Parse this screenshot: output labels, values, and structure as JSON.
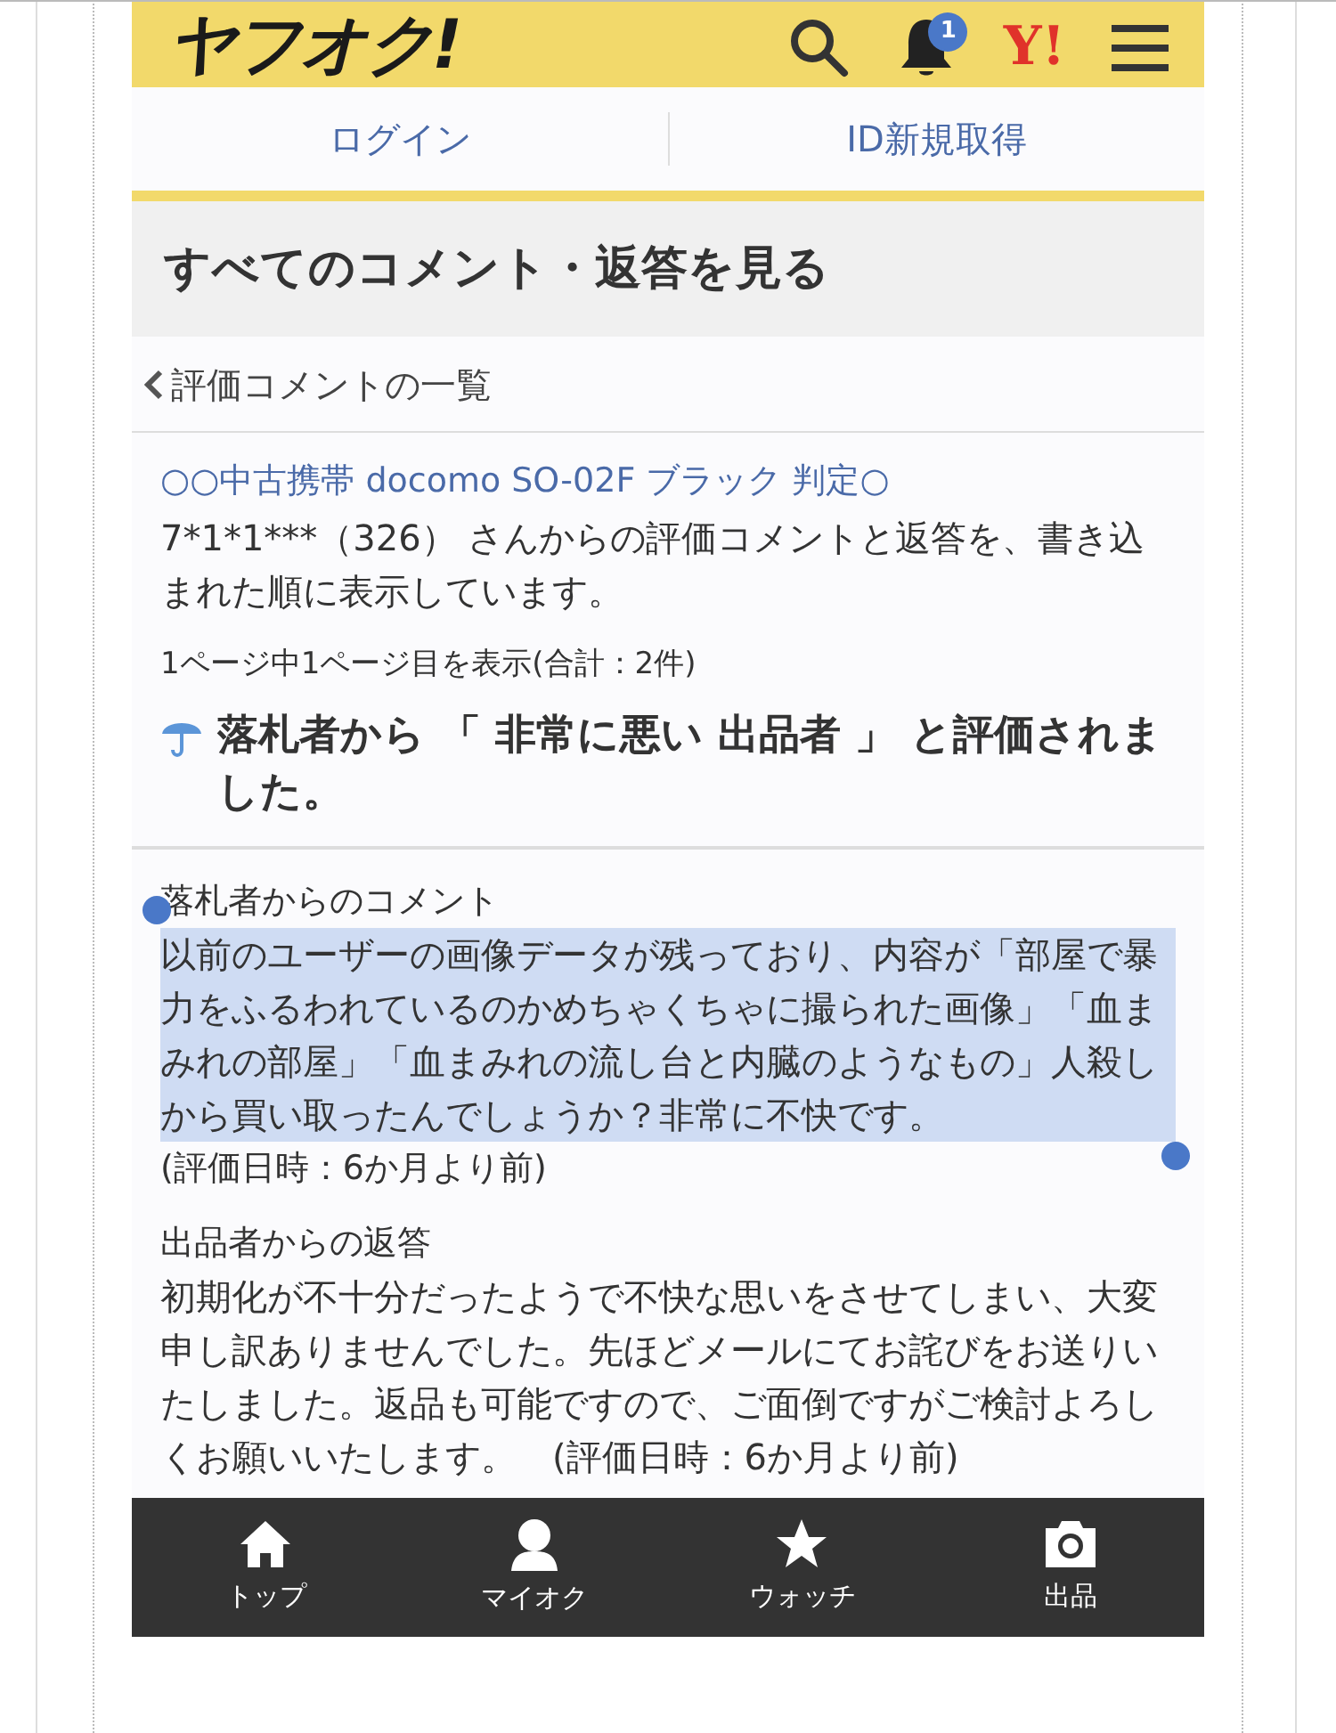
{
  "header": {
    "logo": "ヤフオク!",
    "notification_badge": "1",
    "yahoo_logo": "Y!"
  },
  "auth_links": [
    {
      "label": "ログイン"
    },
    {
      "label": "ID新規取得"
    }
  ],
  "page_title": "すべてのコメント・返答を見る",
  "back_link": "評価コメントの一覧",
  "item": {
    "title": "○○中古携帯 docomo SO-02F ブラック 判定○",
    "description": "7*1*1***（326） さんからの評価コメントと返答を、書き込まれた順に表示しています。",
    "page_info": "1ページ中1ページ目を表示(合計：2件)",
    "rating": "落札者から 「 非常に悪い 出品者 」 と評価されました。"
  },
  "comments": [
    {
      "heading": "落札者からのコメント",
      "body": "以前のユーザーの画像データが残っており、内容が「部屋で暴力をふるわれているのかめちゃくちゃに撮られた画像」「血まみれの部屋」「血まみれの流し台と内臓のようなもの」人殺しから買い取ったんでしょうか？非常に不快です。",
      "date": "(評価日時：6か月より前)",
      "highlighted": true
    },
    {
      "heading": "出品者からの返答",
      "body": "初期化が不十分だったようで不快な思いをさせてしまい、大変申し訳ありませんでした。先ほどメールにてお詫びをお送りいたしました。返品も可能ですので、ご面倒ですがご検討よろしくお願いいたします。　(評価日時：6か月より前)",
      "highlighted": false
    }
  ],
  "bottom_nav": [
    {
      "kind": "home",
      "label": "トップ"
    },
    {
      "kind": "person",
      "label": "マイオク"
    },
    {
      "kind": "star",
      "label": "ウォッチ"
    },
    {
      "kind": "camera",
      "label": "出品"
    }
  ]
}
